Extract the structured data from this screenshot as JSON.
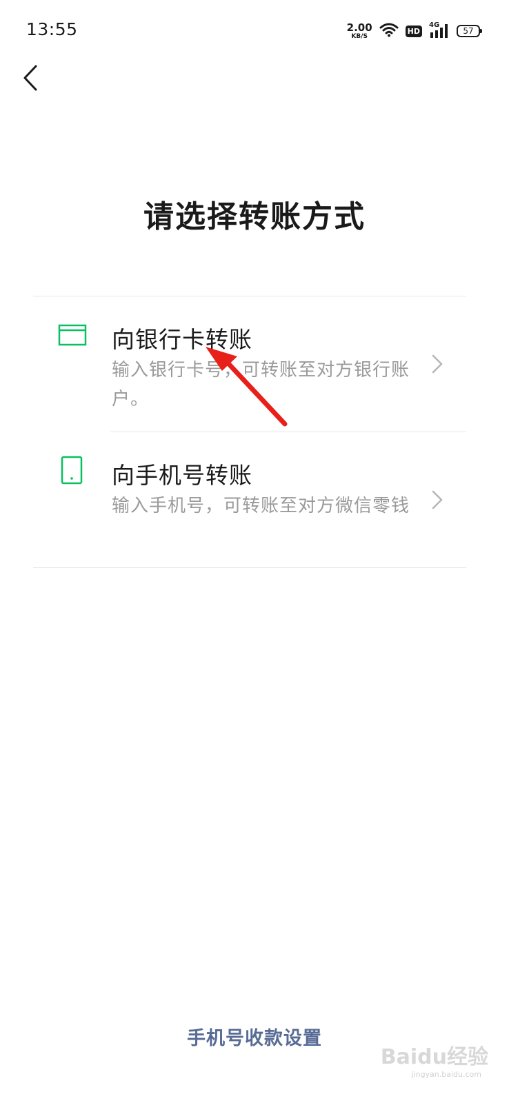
{
  "status_bar": {
    "time": "13:55",
    "net_speed_value": "2.00",
    "net_speed_unit": "KB/S",
    "hd_label": "HD",
    "signal_label": "4G",
    "battery_level": "57",
    "icons": [
      "wifi-icon",
      "hd-icon",
      "signal-icon",
      "battery-icon"
    ]
  },
  "nav": {
    "back_icon": "chevron-left-icon"
  },
  "page": {
    "title": "请选择转账方式"
  },
  "options": [
    {
      "icon": "bank-card-icon",
      "title": "向银行卡转账",
      "description": "输入银行卡号，可转账至对方银行账户。"
    },
    {
      "icon": "mobile-phone-icon",
      "title": "向手机号转账",
      "description": "输入手机号，可转账至对方微信零钱"
    }
  ],
  "footer": {
    "link_label": "手机号收款设置"
  },
  "watermark": {
    "text": "Baidu经验",
    "sub": "jingyan.baidu.com"
  },
  "colors": {
    "accent_green": "#07c160",
    "link_blue": "#576b95",
    "annotation_red": "#e8201a",
    "desc_gray": "#9a9a9a"
  }
}
